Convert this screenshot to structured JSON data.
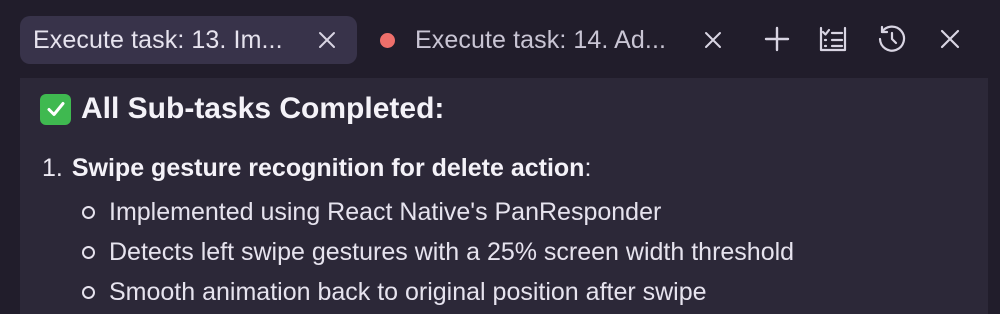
{
  "tabs": [
    {
      "label": "Execute task: 13. Im...",
      "active": true
    },
    {
      "label": "Execute task: 14. Ad...",
      "active": false,
      "status_color": "#ee6f6b"
    }
  ],
  "toolbar": {
    "icons": [
      "plus-icon",
      "task-list-icon",
      "history-icon",
      "close-icon"
    ]
  },
  "content": {
    "heading_icon": "check-mark-icon",
    "heading": "All Sub-tasks Completed:",
    "list": [
      {
        "number": "1.",
        "title": "Swipe gesture recognition for delete action",
        "suffix": ":",
        "items": [
          "Implemented using React Native's PanResponder",
          "Detects left swipe gestures with a 25% screen width threshold",
          "Smooth animation back to original position after swipe"
        ]
      }
    ]
  },
  "colors": {
    "background": "#211d2b",
    "panel": "#2c2838",
    "active_tab": "#38334a",
    "check_green": "#3fb950",
    "unsaved_dot": "#ee6f6b"
  }
}
